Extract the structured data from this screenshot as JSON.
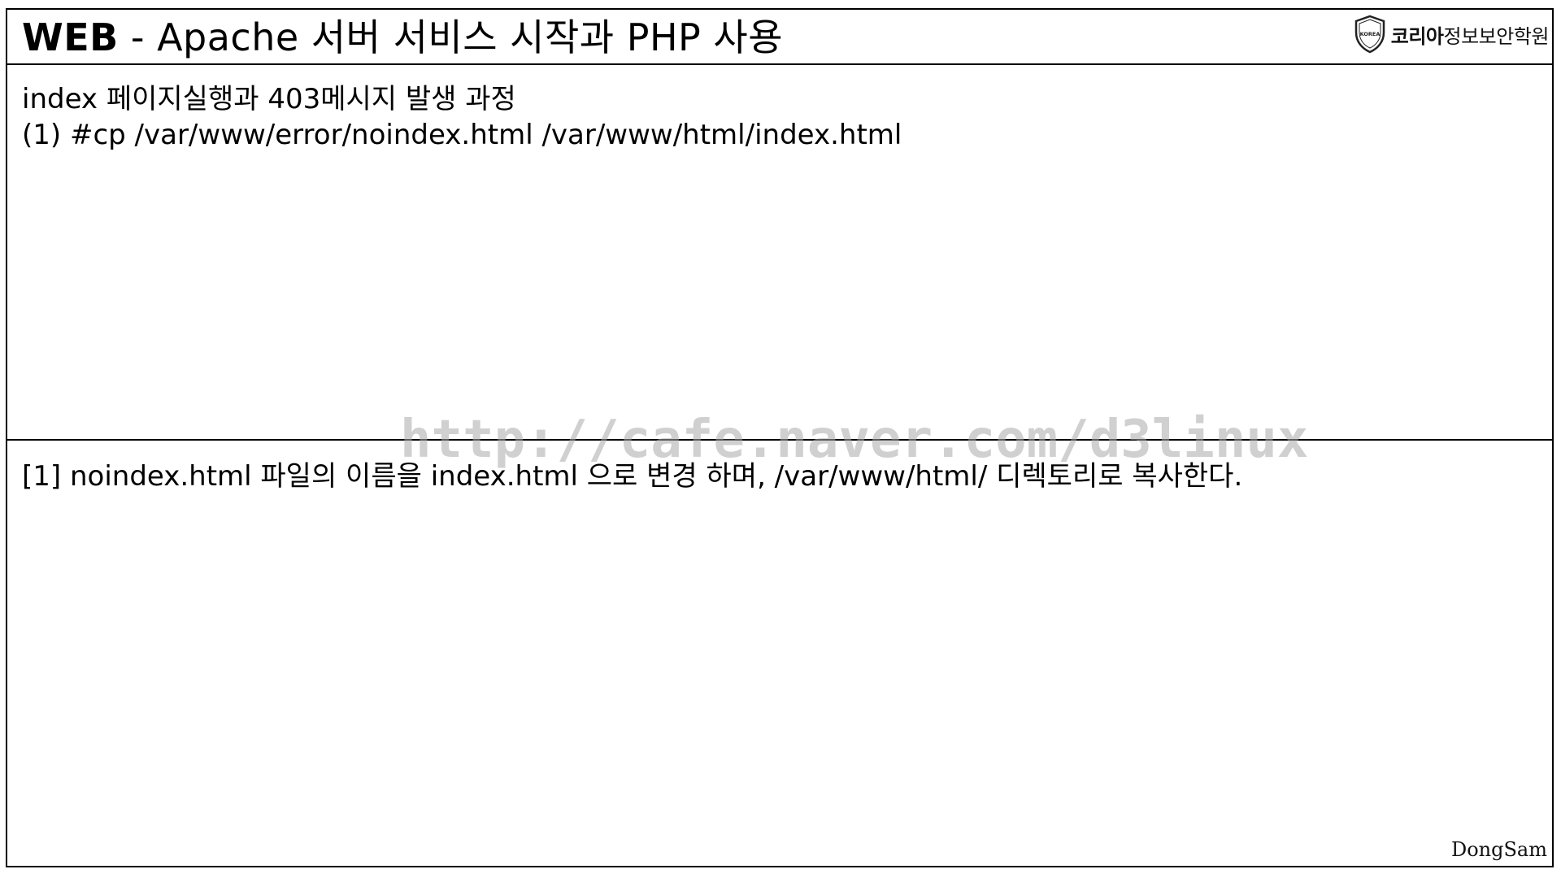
{
  "header": {
    "title_strong": "WEB",
    "title_rest": " - Apache 서버 서비스 시작과 PHP 사용",
    "logo": {
      "icon": "shield-icon",
      "badge_text": "KOREA",
      "name_bold": "코리아",
      "name_regular": "정보보안학원"
    }
  },
  "section_top": {
    "heading": "index 페이지실행과 403메시지 발생 과정",
    "command": "(1) #cp /var/www/error/noindex.html /var/www/html/index.html"
  },
  "section_bottom": {
    "note": "[1] noindex.html 파일의 이름을 index.html 으로 변경 하며, /var/www/html/ 디렉토리로 복사한다."
  },
  "watermark": "http://cafe.naver.com/d3linux",
  "footer": {
    "author": "DongSam"
  },
  "colors": {
    "border": "#000000",
    "background": "#ffffff",
    "watermark": "#aaaaaa"
  }
}
